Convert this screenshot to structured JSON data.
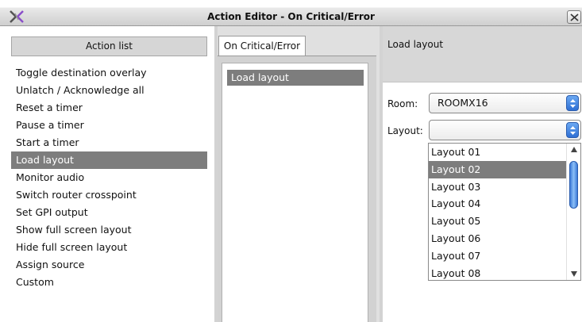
{
  "window": {
    "title": "Action Editor - On Critical/Error",
    "app_icon": "x-logo-icon",
    "close_icon": "close-icon"
  },
  "action_list": {
    "header": "Action list",
    "items": [
      "Toggle destination overlay",
      "Unlatch / Acknowledge all",
      "Reset a timer",
      "Pause a timer",
      "Start a timer",
      "Load layout",
      "Monitor audio",
      "Switch router crosspoint",
      "Set GPI output",
      "Show full screen layout",
      "Hide full screen layout",
      "Assign source",
      "Custom"
    ],
    "selected": "Load layout"
  },
  "event_panel": {
    "tab_label": "On Critical/Error",
    "items": [
      "Load layout"
    ]
  },
  "properties": {
    "header": "Load layout",
    "room_label": "Room:",
    "room_value": "ROOMX16",
    "layout_label": "Layout:",
    "layout_value": "",
    "layout_options": [
      "Layout 01",
      "Layout 02",
      "Layout 03",
      "Layout 04",
      "Layout 05",
      "Layout 06",
      "Layout 07",
      "Layout 08"
    ],
    "highlighted_option": "Layout 02"
  },
  "colors": {
    "selection": "#7d7d7d",
    "header_bg": "#d6d6d6",
    "accent_blue": "#2f6fd4"
  }
}
